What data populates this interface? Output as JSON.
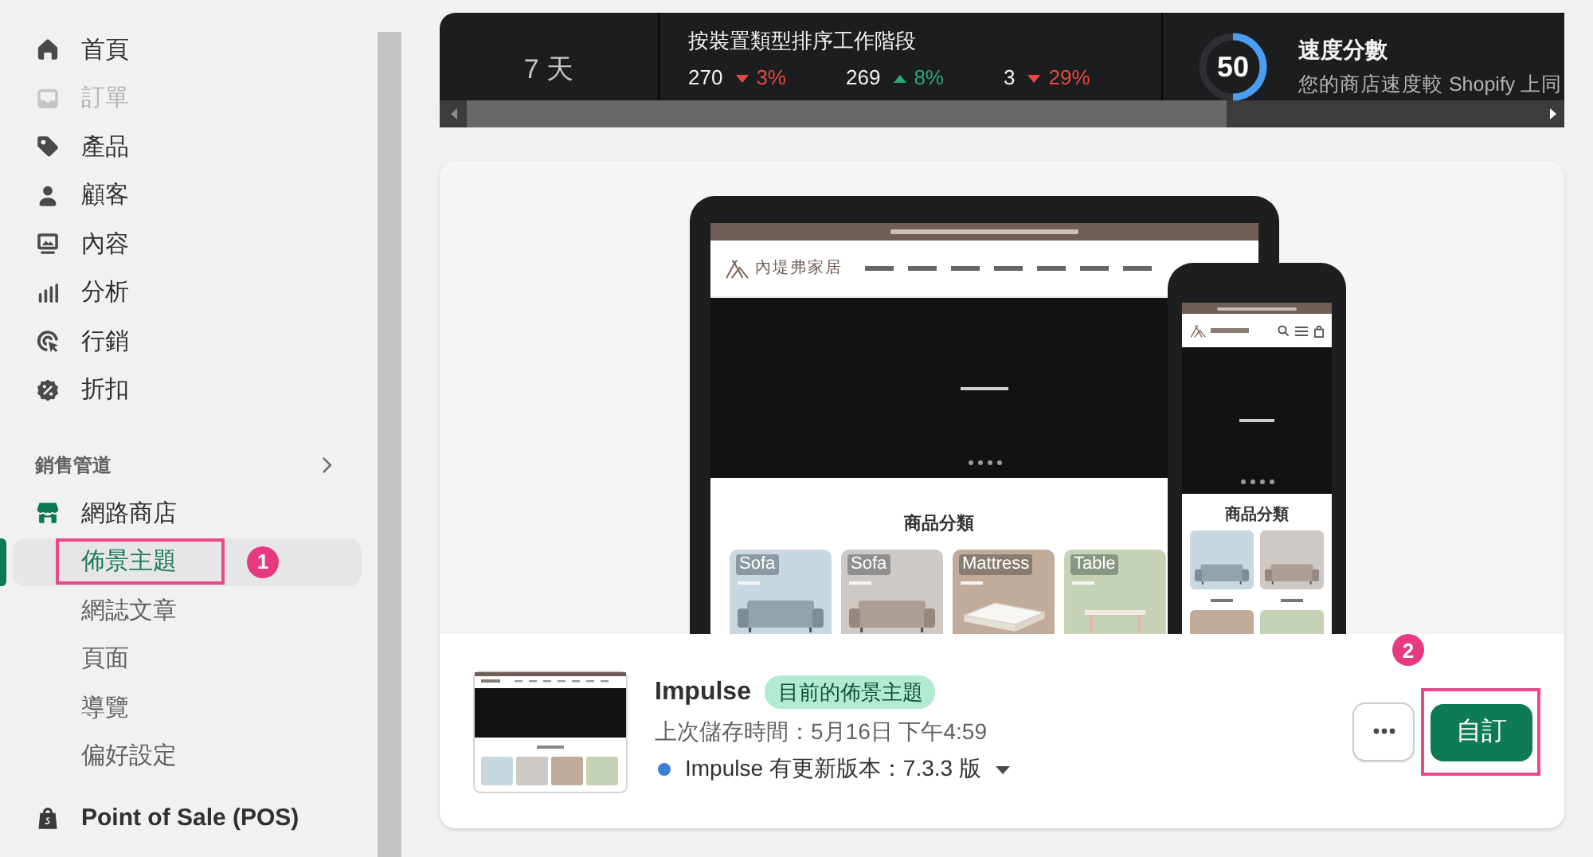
{
  "sidebar": {
    "items": [
      {
        "label": "首頁",
        "disabled": false
      },
      {
        "label": "訂單",
        "disabled": true
      },
      {
        "label": "產品",
        "disabled": false
      },
      {
        "label": "顧客",
        "disabled": false
      },
      {
        "label": "內容",
        "disabled": false
      },
      {
        "label": "分析",
        "disabled": false
      },
      {
        "label": "行銷",
        "disabled": false
      },
      {
        "label": "折扣",
        "disabled": false
      }
    ],
    "channels_header": {
      "label": "銷售管道"
    },
    "channel": {
      "label": "網路商店",
      "children": [
        {
          "label": "佈景主題",
          "selected": true,
          "annotation": "1"
        },
        {
          "label": "網誌文章",
          "selected": false
        },
        {
          "label": "頁面",
          "selected": false
        },
        {
          "label": "導覽",
          "selected": false
        },
        {
          "label": "偏好設定",
          "selected": false
        }
      ]
    },
    "pos": {
      "label": "Point of Sale (POS)"
    }
  },
  "stats": {
    "period": "7 天",
    "sessions": {
      "title": "按裝置類型排序工作階段",
      "values": [
        {
          "value": "270",
          "increase": false,
          "change": "3%"
        },
        {
          "value": "269",
          "increase": true,
          "change": "8%"
        },
        {
          "value": "3",
          "increase": false,
          "change": "29%"
        }
      ]
    },
    "speed": {
      "score": "50",
      "level": 0.5,
      "title": "速度分數",
      "description": "您的商店速度較 Shopify 上同"
    }
  },
  "preview": {
    "logo": "內堤弗家居",
    "section_title": "商品分類",
    "categories": [
      {
        "title": "Sofa",
        "color": "#c8d8e0"
      },
      {
        "title": "Sofa",
        "color": "#cfc9c5"
      },
      {
        "title": "Mattress",
        "color": "#c2ab98"
      },
      {
        "title": "Table",
        "color": "#c5d3b4"
      }
    ],
    "phone": {
      "section_title": "商品分類"
    }
  },
  "theme": {
    "name": "Impulse",
    "badge": "目前的佈景主題",
    "saved": "上次儲存時間：5月16日 下午4:59",
    "update": "Impulse 有更新版本：7.3.3 版",
    "customize": {
      "label": "自訂",
      "annotation": "2"
    }
  }
}
